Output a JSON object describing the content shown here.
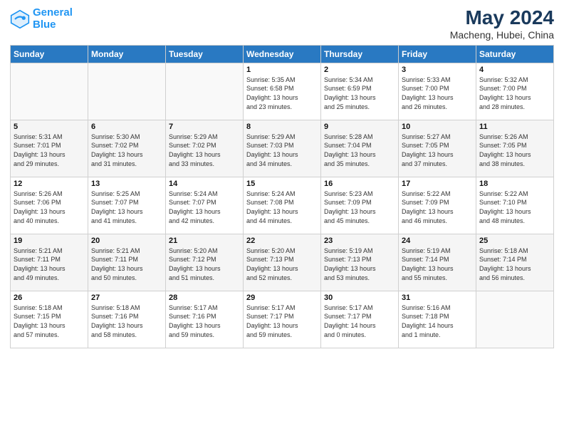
{
  "app": {
    "name": "GeneralBlue",
    "logo_text_1": "General",
    "logo_text_2": "Blue"
  },
  "calendar": {
    "title": "May 2024",
    "subtitle": "Macheng, Hubei, China",
    "headers": [
      "Sunday",
      "Monday",
      "Tuesday",
      "Wednesday",
      "Thursday",
      "Friday",
      "Saturday"
    ],
    "weeks": [
      [
        {
          "day": "",
          "info": ""
        },
        {
          "day": "",
          "info": ""
        },
        {
          "day": "",
          "info": ""
        },
        {
          "day": "1",
          "info": "Sunrise: 5:35 AM\nSunset: 6:58 PM\nDaylight: 13 hours\nand 23 minutes."
        },
        {
          "day": "2",
          "info": "Sunrise: 5:34 AM\nSunset: 6:59 PM\nDaylight: 13 hours\nand 25 minutes."
        },
        {
          "day": "3",
          "info": "Sunrise: 5:33 AM\nSunset: 7:00 PM\nDaylight: 13 hours\nand 26 minutes."
        },
        {
          "day": "4",
          "info": "Sunrise: 5:32 AM\nSunset: 7:00 PM\nDaylight: 13 hours\nand 28 minutes."
        }
      ],
      [
        {
          "day": "5",
          "info": "Sunrise: 5:31 AM\nSunset: 7:01 PM\nDaylight: 13 hours\nand 29 minutes."
        },
        {
          "day": "6",
          "info": "Sunrise: 5:30 AM\nSunset: 7:02 PM\nDaylight: 13 hours\nand 31 minutes."
        },
        {
          "day": "7",
          "info": "Sunrise: 5:29 AM\nSunset: 7:02 PM\nDaylight: 13 hours\nand 33 minutes."
        },
        {
          "day": "8",
          "info": "Sunrise: 5:29 AM\nSunset: 7:03 PM\nDaylight: 13 hours\nand 34 minutes."
        },
        {
          "day": "9",
          "info": "Sunrise: 5:28 AM\nSunset: 7:04 PM\nDaylight: 13 hours\nand 35 minutes."
        },
        {
          "day": "10",
          "info": "Sunrise: 5:27 AM\nSunset: 7:05 PM\nDaylight: 13 hours\nand 37 minutes."
        },
        {
          "day": "11",
          "info": "Sunrise: 5:26 AM\nSunset: 7:05 PM\nDaylight: 13 hours\nand 38 minutes."
        }
      ],
      [
        {
          "day": "12",
          "info": "Sunrise: 5:26 AM\nSunset: 7:06 PM\nDaylight: 13 hours\nand 40 minutes."
        },
        {
          "day": "13",
          "info": "Sunrise: 5:25 AM\nSunset: 7:07 PM\nDaylight: 13 hours\nand 41 minutes."
        },
        {
          "day": "14",
          "info": "Sunrise: 5:24 AM\nSunset: 7:07 PM\nDaylight: 13 hours\nand 42 minutes."
        },
        {
          "day": "15",
          "info": "Sunrise: 5:24 AM\nSunset: 7:08 PM\nDaylight: 13 hours\nand 44 minutes."
        },
        {
          "day": "16",
          "info": "Sunrise: 5:23 AM\nSunset: 7:09 PM\nDaylight: 13 hours\nand 45 minutes."
        },
        {
          "day": "17",
          "info": "Sunrise: 5:22 AM\nSunset: 7:09 PM\nDaylight: 13 hours\nand 46 minutes."
        },
        {
          "day": "18",
          "info": "Sunrise: 5:22 AM\nSunset: 7:10 PM\nDaylight: 13 hours\nand 48 minutes."
        }
      ],
      [
        {
          "day": "19",
          "info": "Sunrise: 5:21 AM\nSunset: 7:11 PM\nDaylight: 13 hours\nand 49 minutes."
        },
        {
          "day": "20",
          "info": "Sunrise: 5:21 AM\nSunset: 7:11 PM\nDaylight: 13 hours\nand 50 minutes."
        },
        {
          "day": "21",
          "info": "Sunrise: 5:20 AM\nSunset: 7:12 PM\nDaylight: 13 hours\nand 51 minutes."
        },
        {
          "day": "22",
          "info": "Sunrise: 5:20 AM\nSunset: 7:13 PM\nDaylight: 13 hours\nand 52 minutes."
        },
        {
          "day": "23",
          "info": "Sunrise: 5:19 AM\nSunset: 7:13 PM\nDaylight: 13 hours\nand 53 minutes."
        },
        {
          "day": "24",
          "info": "Sunrise: 5:19 AM\nSunset: 7:14 PM\nDaylight: 13 hours\nand 55 minutes."
        },
        {
          "day": "25",
          "info": "Sunrise: 5:18 AM\nSunset: 7:14 PM\nDaylight: 13 hours\nand 56 minutes."
        }
      ],
      [
        {
          "day": "26",
          "info": "Sunrise: 5:18 AM\nSunset: 7:15 PM\nDaylight: 13 hours\nand 57 minutes."
        },
        {
          "day": "27",
          "info": "Sunrise: 5:18 AM\nSunset: 7:16 PM\nDaylight: 13 hours\nand 58 minutes."
        },
        {
          "day": "28",
          "info": "Sunrise: 5:17 AM\nSunset: 7:16 PM\nDaylight: 13 hours\nand 59 minutes."
        },
        {
          "day": "29",
          "info": "Sunrise: 5:17 AM\nSunset: 7:17 PM\nDaylight: 13 hours\nand 59 minutes."
        },
        {
          "day": "30",
          "info": "Sunrise: 5:17 AM\nSunset: 7:17 PM\nDaylight: 14 hours\nand 0 minutes."
        },
        {
          "day": "31",
          "info": "Sunrise: 5:16 AM\nSunset: 7:18 PM\nDaylight: 14 hours\nand 1 minute."
        },
        {
          "day": "",
          "info": ""
        }
      ]
    ]
  }
}
